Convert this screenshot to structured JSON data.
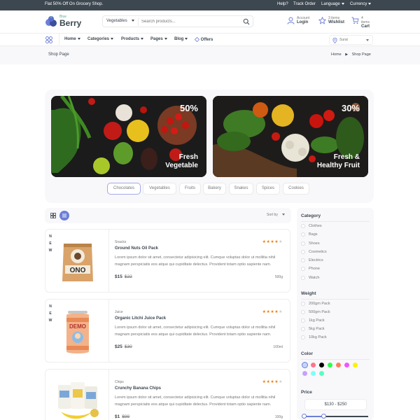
{
  "topbar": {
    "promo": "Flat 50% Off On Grocery Shop.",
    "links": [
      "Help?",
      "Track Order",
      "Language",
      "Currency"
    ]
  },
  "logo": {
    "small": "Blue",
    "big": "Berry"
  },
  "search": {
    "category": "Vegetables",
    "placeholder": "Search products..."
  },
  "header_actions": [
    {
      "line1": "Account",
      "line2": "Login",
      "icon": "user-icon"
    },
    {
      "line1": "3 items",
      "line2": "Wishlist",
      "icon": "heart-icon"
    },
    {
      "line1": "4 items",
      "line2": "Cart",
      "icon": "cart-icon"
    }
  ],
  "nav": {
    "items": [
      "Home",
      "Categories",
      "Products",
      "Pages",
      "Blog"
    ],
    "offers": "Offers",
    "location": "Surat"
  },
  "breadcrumb": {
    "title": "Shop Page",
    "home": "Home",
    "current": "Shop Page"
  },
  "banners": [
    {
      "percent": "50%",
      "caption_l1": "Fresh",
      "caption_l2": "Vegetable"
    },
    {
      "percent": "30%",
      "caption_l1": "Fresh &",
      "caption_l2": "Healthy Fruit"
    }
  ],
  "chips": [
    "Chocolates",
    "Vegetables",
    "Fruits",
    "Bakery",
    "Snakes",
    "Spices",
    "Cookies"
  ],
  "toolbar": {
    "sort": "Sort by"
  },
  "products": [
    {
      "badge": [
        "N",
        "E",
        "W"
      ],
      "category": "Snacks",
      "name": "Ground Nuts Oil Pack",
      "rating": 4,
      "description": "Lorem ipsum dolor sit amet, consectetur adipisicing elit. Cumque voluptas dolor ut mollitia nihil magnam perspiciatis eos atque qui cupiditate delectus. Provident totam optio sapiente nam.",
      "price": "$15",
      "old_price": "$22",
      "weight": "500g",
      "product_label": "ONO"
    },
    {
      "badge": [
        "N",
        "E",
        "W"
      ],
      "category": "Juice",
      "name": "Organic Litchi Juice Pack",
      "rating": 4,
      "description": "Lorem ipsum dolor sit amet, consectetur adipisicing elit. Cumque voluptas dolor ut mollitia nihil magnam perspiciatis eos atque qui cupiditate delectus. Provident totam optio sapiente nam.",
      "price": "$25",
      "old_price": "$30",
      "weight": "100ml",
      "product_label": "DEMO"
    },
    {
      "badge": [],
      "category": "Chips",
      "name": "Crunchy Banana Chips",
      "rating": 4,
      "description": "Lorem ipsum dolor sit amet, consectetur adipisicing elit. Cumque voluptas dolor ut mollitia nihil magnam perspiciatis eos atque qui cupiditate delectus. Provident totam optio sapiente nam.",
      "price": "$1",
      "old_price": "$99",
      "weight": "100g",
      "product_label": ""
    }
  ],
  "sidebar": {
    "category_title": "Category",
    "categories": [
      "Clothes",
      "Bags",
      "Shoes",
      "Cosmetics",
      "Electrics",
      "Phone",
      "Watch"
    ],
    "weight_title": "Weight",
    "weights": [
      "200gm Pack",
      "500gm Pack",
      "1kg Pack",
      "5kg Pack",
      "10kg Pack"
    ],
    "color_title": "Color",
    "colors": [
      "#c4d6f9",
      "#ff748b",
      "#000000",
      "#2bff4a",
      "#ff7c5e",
      "#f155ff",
      "#ffef00",
      "#c89fff",
      "#7bfffa",
      "#56ffc1"
    ],
    "price_title": "Price",
    "price_range": "$130 - $250",
    "price_range_min_fraction": 0.03,
    "price_range_max_fraction": 0.32
  }
}
